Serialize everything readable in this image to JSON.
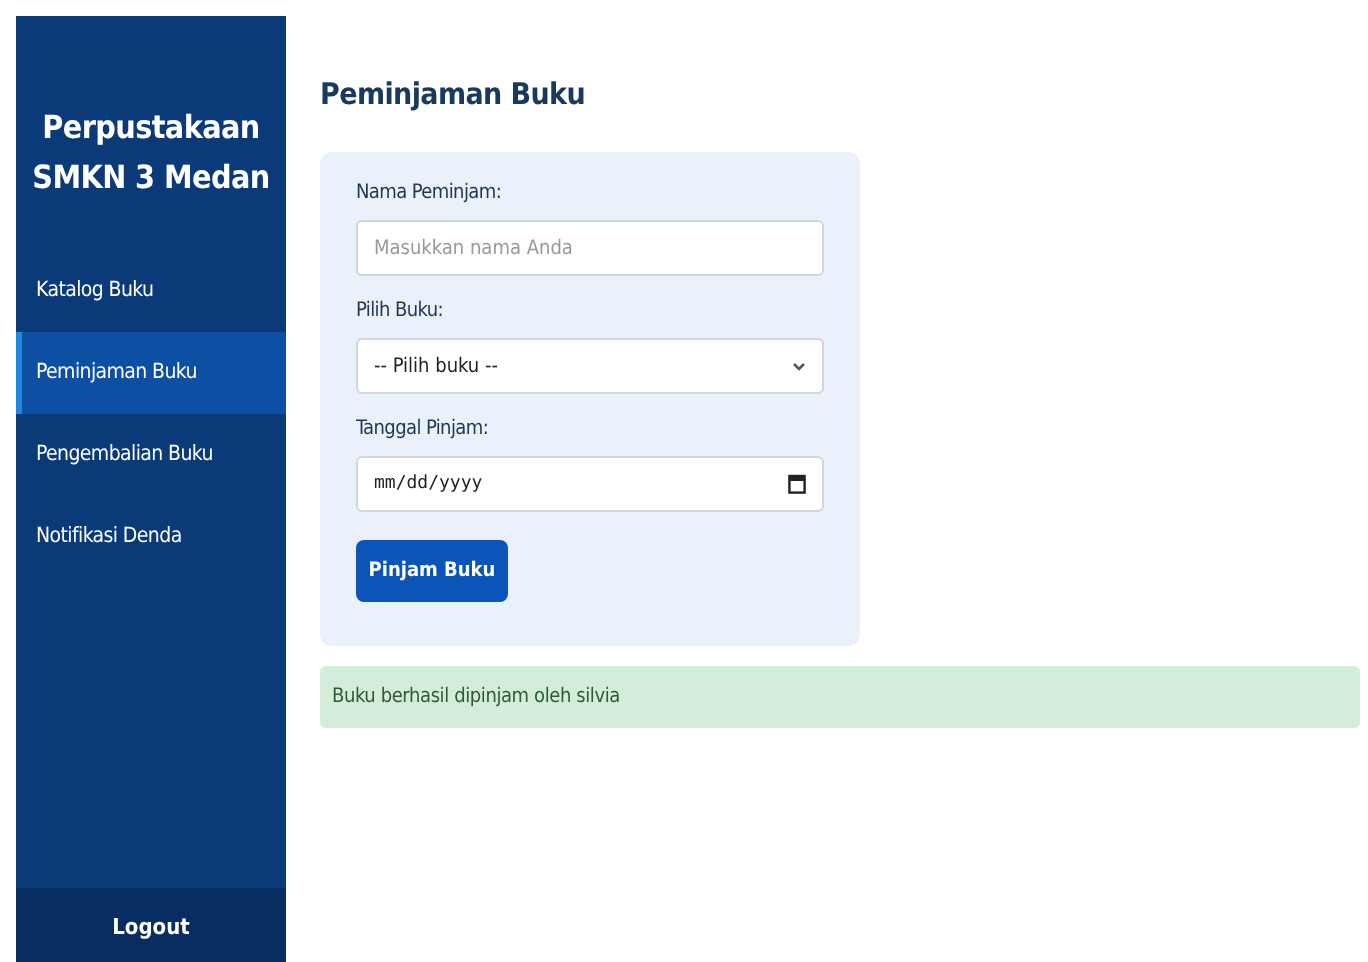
{
  "sidebar": {
    "title": "Perpustakaan SMKN 3 Medan",
    "items": [
      {
        "label": "Katalog Buku",
        "selected": false
      },
      {
        "label": "Peminjaman Buku",
        "selected": true
      },
      {
        "label": "Pengembalian Buku",
        "selected": false
      },
      {
        "label": "Notifikasi Denda",
        "selected": false
      }
    ],
    "logout": "Logout"
  },
  "page_title": "Peminjaman Buku",
  "form": {
    "fields": [
      {
        "kind": "text",
        "label": "Nama Peminjam:",
        "placeholder": "Masukkan nama Anda"
      },
      {
        "kind": "select",
        "label": "Pilih Buku:",
        "value": "-- Pilih buku --"
      },
      {
        "kind": "date",
        "label": "Tanggal Pinjam:",
        "placeholder": "mm/dd/yyyy"
      }
    ],
    "submit": "Pinjam Buku"
  },
  "alert": "Buku berhasil dipinjam oleh silvia"
}
